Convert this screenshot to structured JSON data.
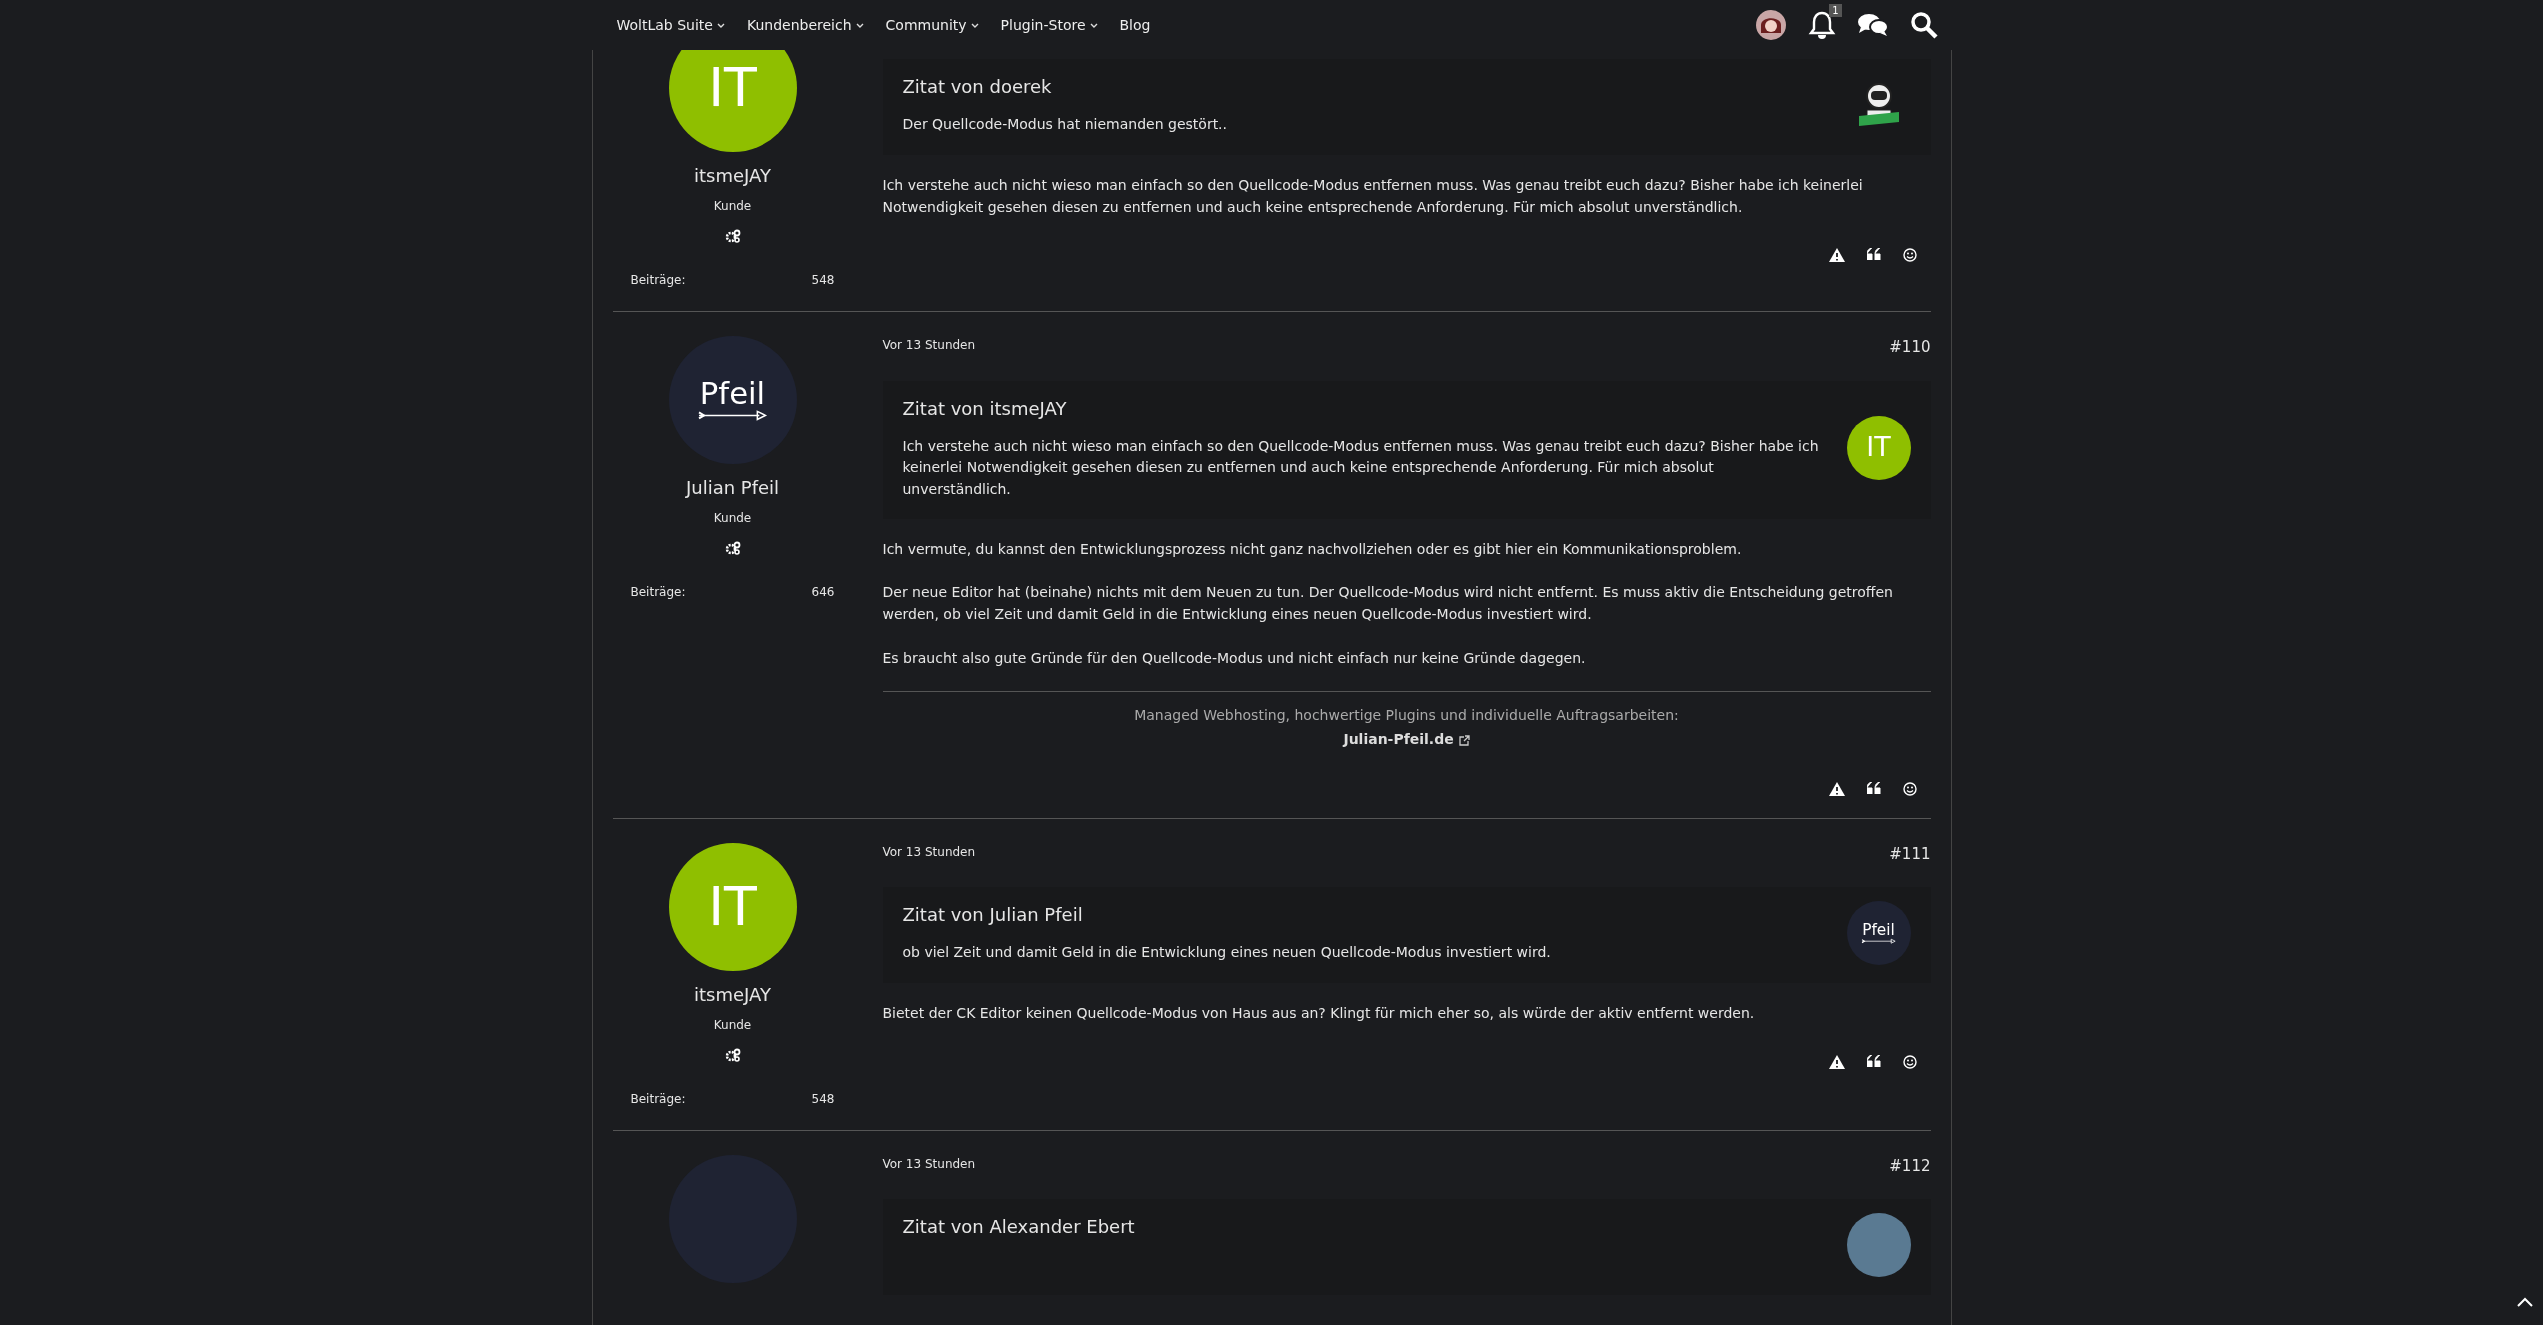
{
  "nav": {
    "items": [
      {
        "label": "WoltLab Suite",
        "dropdown": true
      },
      {
        "label": "Kundenbereich",
        "dropdown": true
      },
      {
        "label": "Community",
        "dropdown": true
      },
      {
        "label": "Plugin-Store",
        "dropdown": true
      },
      {
        "label": "Blog",
        "dropdown": false
      }
    ],
    "notification_count": "1"
  },
  "posts": [
    {
      "author": "itsmeJAY",
      "avatar": {
        "kind": "initials",
        "text": "IT"
      },
      "rank": "Kunde",
      "stat_label": "Beiträge:",
      "stat_value": "548",
      "quote": {
        "title": "Zitat von doerek",
        "text": "Der Quellcode-Modus hat niemanden gestört..",
        "avatar": {
          "kind": "image"
        }
      },
      "paragraphs": [
        "Ich verstehe auch nicht wieso man einfach so den Quellcode-Modus entfernen muss. Was genau treibt euch dazu? Bisher habe ich keinerlei Notwendigkeit gesehen diesen zu entfernen und auch keine entsprechende Anforderung. Für mich absolut unverständlich."
      ]
    },
    {
      "author": "Julian Pfeil",
      "avatar": {
        "kind": "logo",
        "text": "Pfeil"
      },
      "rank": "Kunde",
      "stat_label": "Beiträge:",
      "stat_value": "646",
      "time": "Vor 13 Stunden",
      "number": "#110",
      "quote": {
        "title": "Zitat von itsmeJAY",
        "text": "Ich verstehe auch nicht wieso man einfach so den Quellcode-Modus entfernen muss. Was genau treibt euch dazu? Bisher habe ich keinerlei Notwendigkeit gesehen diesen zu entfernen und auch keine entsprechende Anforderung. Für mich absolut unverständlich.",
        "avatar": {
          "kind": "initials",
          "text": "IT"
        }
      },
      "paragraphs": [
        "Ich vermute, du kannst den Entwicklungsprozess nicht ganz nachvollziehen oder es gibt hier ein Kommunikationsproblem.",
        "Der neue Editor hat (beinahe) nichts mit dem Neuen zu tun. Der Quellcode-Modus wird nicht entfernt. Es muss aktiv die Entscheidung getroffen werden, ob viel Zeit und damit Geld in die Entwicklung eines neuen Quellcode-Modus investiert wird.",
        "Es braucht also gute Gründe für den Quellcode-Modus und nicht einfach nur keine Gründe dagegen."
      ],
      "signature": {
        "text": "Managed Webhosting, hochwertige Plugins und individuelle Auftragsarbeiten:",
        "link": "Julian-Pfeil.de"
      }
    },
    {
      "author": "itsmeJAY",
      "avatar": {
        "kind": "initials",
        "text": "IT"
      },
      "rank": "Kunde",
      "stat_label": "Beiträge:",
      "stat_value": "548",
      "time": "Vor 13 Stunden",
      "number": "#111",
      "quote": {
        "title": "Zitat von Julian Pfeil",
        "text": "ob viel Zeit und damit Geld in die Entwicklung eines neuen Quellcode-Modus investiert wird.",
        "avatar": {
          "kind": "logo",
          "text": "Pfeil"
        }
      },
      "paragraphs": [
        "Bietet der CK Editor keinen Quellcode-Modus von Haus aus an? Klingt für mich eher so, als würde der aktiv entfernt werden."
      ]
    },
    {
      "avatar": {
        "kind": "blank"
      },
      "time": "Vor 13 Stunden",
      "number": "#112",
      "quote": {
        "title": "Zitat von Alexander Ebert",
        "avatar": {
          "kind": "photo"
        }
      }
    }
  ]
}
